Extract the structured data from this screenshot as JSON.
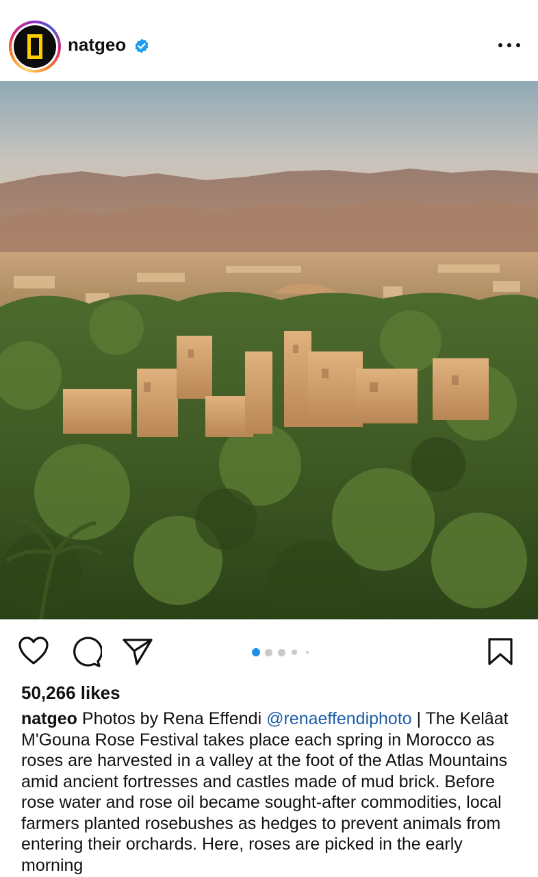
{
  "post": {
    "username": "natgeo",
    "verified": true,
    "more_icon": "more-horizontal-icon",
    "likes_text": "50,266 likes",
    "carousel": {
      "total": 5,
      "active_index": 0
    },
    "caption": {
      "author": "natgeo",
      "lead": "Photos by Rena Effendi",
      "mention": "@renaeffendiphoto",
      "body": "| The Kelâat M'Gouna Rose Festival takes place each spring in Morocco as roses are harvested in a valley at the foot of the Atlas Mountains amid ancient fortresses and castles made of mud brick. Before rose water and rose oil became sought-after commodities, local farmers planted rosebushes as hedges to prevent animals from entering their orchards. Here, roses are picked in the early morning"
    },
    "icons": {
      "like": "heart-icon",
      "comment": "comment-icon",
      "share": "send-icon",
      "save": "bookmark-icon"
    }
  },
  "colors": {
    "accent_blue": "#1f5ea8",
    "verified_blue": "#1d9bf0",
    "dot_active": "#1d8fe6",
    "dot_inactive": "#c9c9c9",
    "logo_yellow": "#ffce00"
  }
}
